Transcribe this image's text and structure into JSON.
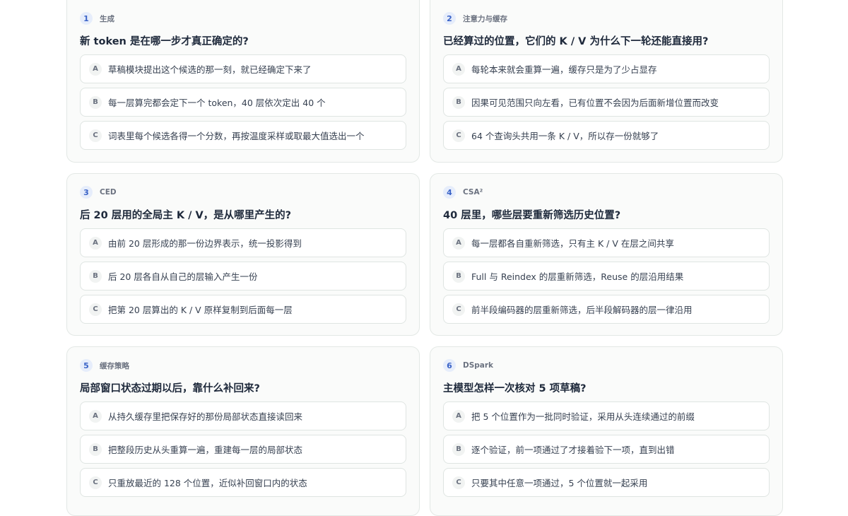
{
  "quiz": {
    "cards": [
      {
        "number": "1",
        "tag": "生成",
        "question": "新 token 是在哪一步才真正确定的?",
        "options": [
          {
            "letter": "A",
            "text": "草稿模块提出这个候选的那一刻，就已经确定下来了"
          },
          {
            "letter": "B",
            "text": "每一层算完都会定下一个 token，40 层依次定出 40 个"
          },
          {
            "letter": "C",
            "text": "词表里每个候选各得一个分数，再按温度采样或取最大值选出一个"
          }
        ]
      },
      {
        "number": "2",
        "tag": "注意力与缓存",
        "question": "已经算过的位置，它们的 K / V 为什么下一轮还能直接用?",
        "options": [
          {
            "letter": "A",
            "text": "每轮本来就会重算一遍，缓存只是为了少占显存"
          },
          {
            "letter": "B",
            "text": "因果可见范围只向左看，已有位置不会因为后面新增位置而改变"
          },
          {
            "letter": "C",
            "text": "64 个查询头共用一条 K / V，所以存一份就够了"
          }
        ]
      },
      {
        "number": "3",
        "tag": "CED",
        "question": "后 20 层用的全局主 K / V，是从哪里产生的?",
        "options": [
          {
            "letter": "A",
            "text": "由前 20 层形成的那一份边界表示，统一投影得到"
          },
          {
            "letter": "B",
            "text": "后 20 层各自从自己的层输入产生一份"
          },
          {
            "letter": "C",
            "text": "把第 20 层算出的 K / V 原样复制到后面每一层"
          }
        ]
      },
      {
        "number": "4",
        "tag": "CSA²",
        "question": "40 层里，哪些层要重新筛选历史位置?",
        "options": [
          {
            "letter": "A",
            "text": "每一层都各自重新筛选，只有主 K / V 在层之间共享"
          },
          {
            "letter": "B",
            "text": "Full 与 Reindex 的层重新筛选，Reuse 的层沿用结果"
          },
          {
            "letter": "C",
            "text": "前半段编码器的层重新筛选，后半段解码器的层一律沿用"
          }
        ]
      },
      {
        "number": "5",
        "tag": "缓存策略",
        "question": "局部窗口状态过期以后，靠什么补回来?",
        "options": [
          {
            "letter": "A",
            "text": "从持久缓存里把保存好的那份局部状态直接读回来"
          },
          {
            "letter": "B",
            "text": "把整段历史从头重算一遍，重建每一层的局部状态"
          },
          {
            "letter": "C",
            "text": "只重放最近的 128 个位置，近似补回窗口内的状态"
          }
        ]
      },
      {
        "number": "6",
        "tag": "DSpark",
        "question": "主模型怎样一次核对 5 项草稿?",
        "options": [
          {
            "letter": "A",
            "text": "把 5 个位置作为一批同时验证，采用从头连续通过的前缀"
          },
          {
            "letter": "B",
            "text": "逐个验证，前一项通过了才接着验下一项，直到出错"
          },
          {
            "letter": "C",
            "text": "只要其中任意一项通过，5 个位置就一起采用"
          }
        ]
      }
    ]
  },
  "colors": {
    "accent": "#3a63c7",
    "badge_bg": "#e6edfb",
    "card_bg": "#fafbfa",
    "border": "#e3e8e5"
  }
}
